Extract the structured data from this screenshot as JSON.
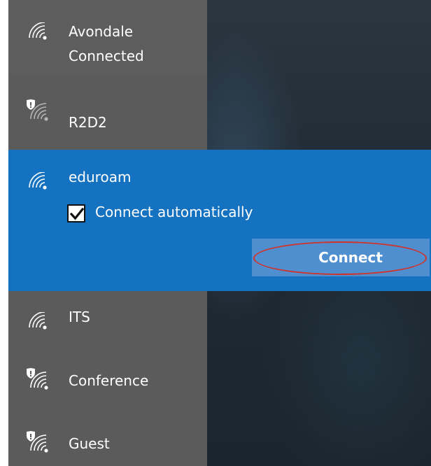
{
  "networks": [
    {
      "name": "Avondale",
      "status": "Connected",
      "secured": false
    },
    {
      "name": "R2D2",
      "secured": true
    },
    {
      "name": "eduroam",
      "secured": false
    },
    {
      "name": "ITS",
      "secured": false
    },
    {
      "name": "Conference",
      "secured": true
    },
    {
      "name": "Guest",
      "secured": true
    }
  ],
  "selected_network": {
    "auto_connect_label": "Connect automatically",
    "auto_connect_checked": true,
    "connect_label": "Connect"
  },
  "colors": {
    "panel_bg": "#5b5b5b",
    "selected_bg": "#1472c0",
    "button_bg": "#4f8fcf",
    "highlight_ring": "#d0332b"
  },
  "icons": {
    "wifi": "wifi-signal-icon",
    "secured": "shield-icon",
    "check": "checkmark-icon"
  }
}
